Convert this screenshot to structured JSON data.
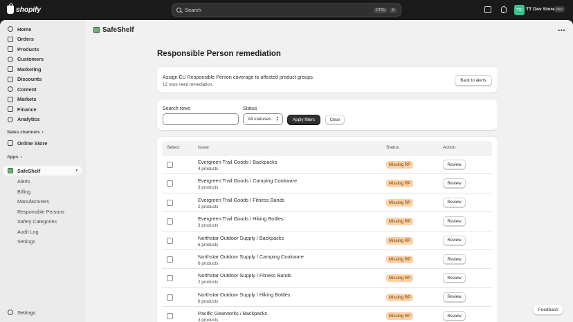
{
  "topbar": {
    "logo_text": "shopify",
    "search_placeholder": "Search",
    "shortcut_ctrl": "CTRL",
    "shortcut_key": "K",
    "store_initials": "TTD",
    "store_name": "TT Dev Store",
    "store_badge": "dev"
  },
  "sidebar": {
    "main_items": [
      {
        "label": "Home",
        "icon": "home-icon"
      },
      {
        "label": "Orders",
        "icon": "orders-icon"
      },
      {
        "label": "Products",
        "icon": "products-icon"
      },
      {
        "label": "Customers",
        "icon": "customers-icon"
      },
      {
        "label": "Marketing",
        "icon": "marketing-icon"
      },
      {
        "label": "Discounts",
        "icon": "discounts-icon"
      },
      {
        "label": "Content",
        "icon": "content-icon"
      },
      {
        "label": "Markets",
        "icon": "markets-icon"
      },
      {
        "label": "Finance",
        "icon": "finance-icon"
      },
      {
        "label": "Analytics",
        "icon": "analytics-icon"
      }
    ],
    "sales_channels_label": "Sales channels",
    "online_store_label": "Online Store",
    "apps_label": "Apps",
    "app_name": "SafeShelf",
    "app_subitems": [
      "Alerts",
      "Billing",
      "Manufacturers",
      "Responsible Persons",
      "Safety Categories",
      "Audit Log",
      "Settings"
    ],
    "settings_label": "Settings"
  },
  "app": {
    "title": "SafeShelf"
  },
  "page": {
    "title": "Responsible Person remediation",
    "description": "Assign EU Responsible Person coverage to affected product groups.",
    "rows_summary": "12 rows need remediation.",
    "back_button": "Back to alerts"
  },
  "filters": {
    "search_label": "Search rows",
    "search_value": "",
    "status_label": "Status",
    "status_selected": "All statuses",
    "apply_button": "Apply filters",
    "clear_button": "Clear"
  },
  "table": {
    "headers": {
      "select": "Select",
      "issue": "Issue",
      "status": "Status",
      "action": "Action"
    },
    "rows": [
      {
        "issue": "Evergreen Trail Goods / Backpacks",
        "count": "4 products",
        "status": "Missing RP",
        "action": "Review"
      },
      {
        "issue": "Evergreen Trail Goods / Camping Cookware",
        "count": "3 products",
        "status": "Missing RP",
        "action": "Review"
      },
      {
        "issue": "Evergreen Trail Goods / Fitness Bands",
        "count": "2 products",
        "status": "Missing RP",
        "action": "Review"
      },
      {
        "issue": "Evergreen Trail Goods / Hiking Bottles",
        "count": "3 products",
        "status": "Missing RP",
        "action": "Review"
      },
      {
        "issue": "Northstar Outdoor Supply / Backpacks",
        "count": "6 products",
        "status": "Missing RP",
        "action": "Review"
      },
      {
        "issue": "Northstar Outdoor Supply / Camping Cookware",
        "count": "6 products",
        "status": "Missing RP",
        "action": "Review"
      },
      {
        "issue": "Northstar Outdoor Supply / Fitness Bands",
        "count": "2 products",
        "status": "Missing RP",
        "action": "Review"
      },
      {
        "issue": "Northstar Outdoor Supply / Hiking Bottles",
        "count": "6 products",
        "status": "Missing RP",
        "action": "Review"
      },
      {
        "issue": "Pacific Gearworks / Backpacks",
        "count": "3 products",
        "status": "Missing RP",
        "action": "Review"
      }
    ]
  },
  "feedback_label": "Feedback",
  "colors": {
    "badge_bg": "#fed1a7",
    "badge_text": "#5e4200",
    "primary_button": "#303030",
    "store_avatar": "#36c28e"
  }
}
